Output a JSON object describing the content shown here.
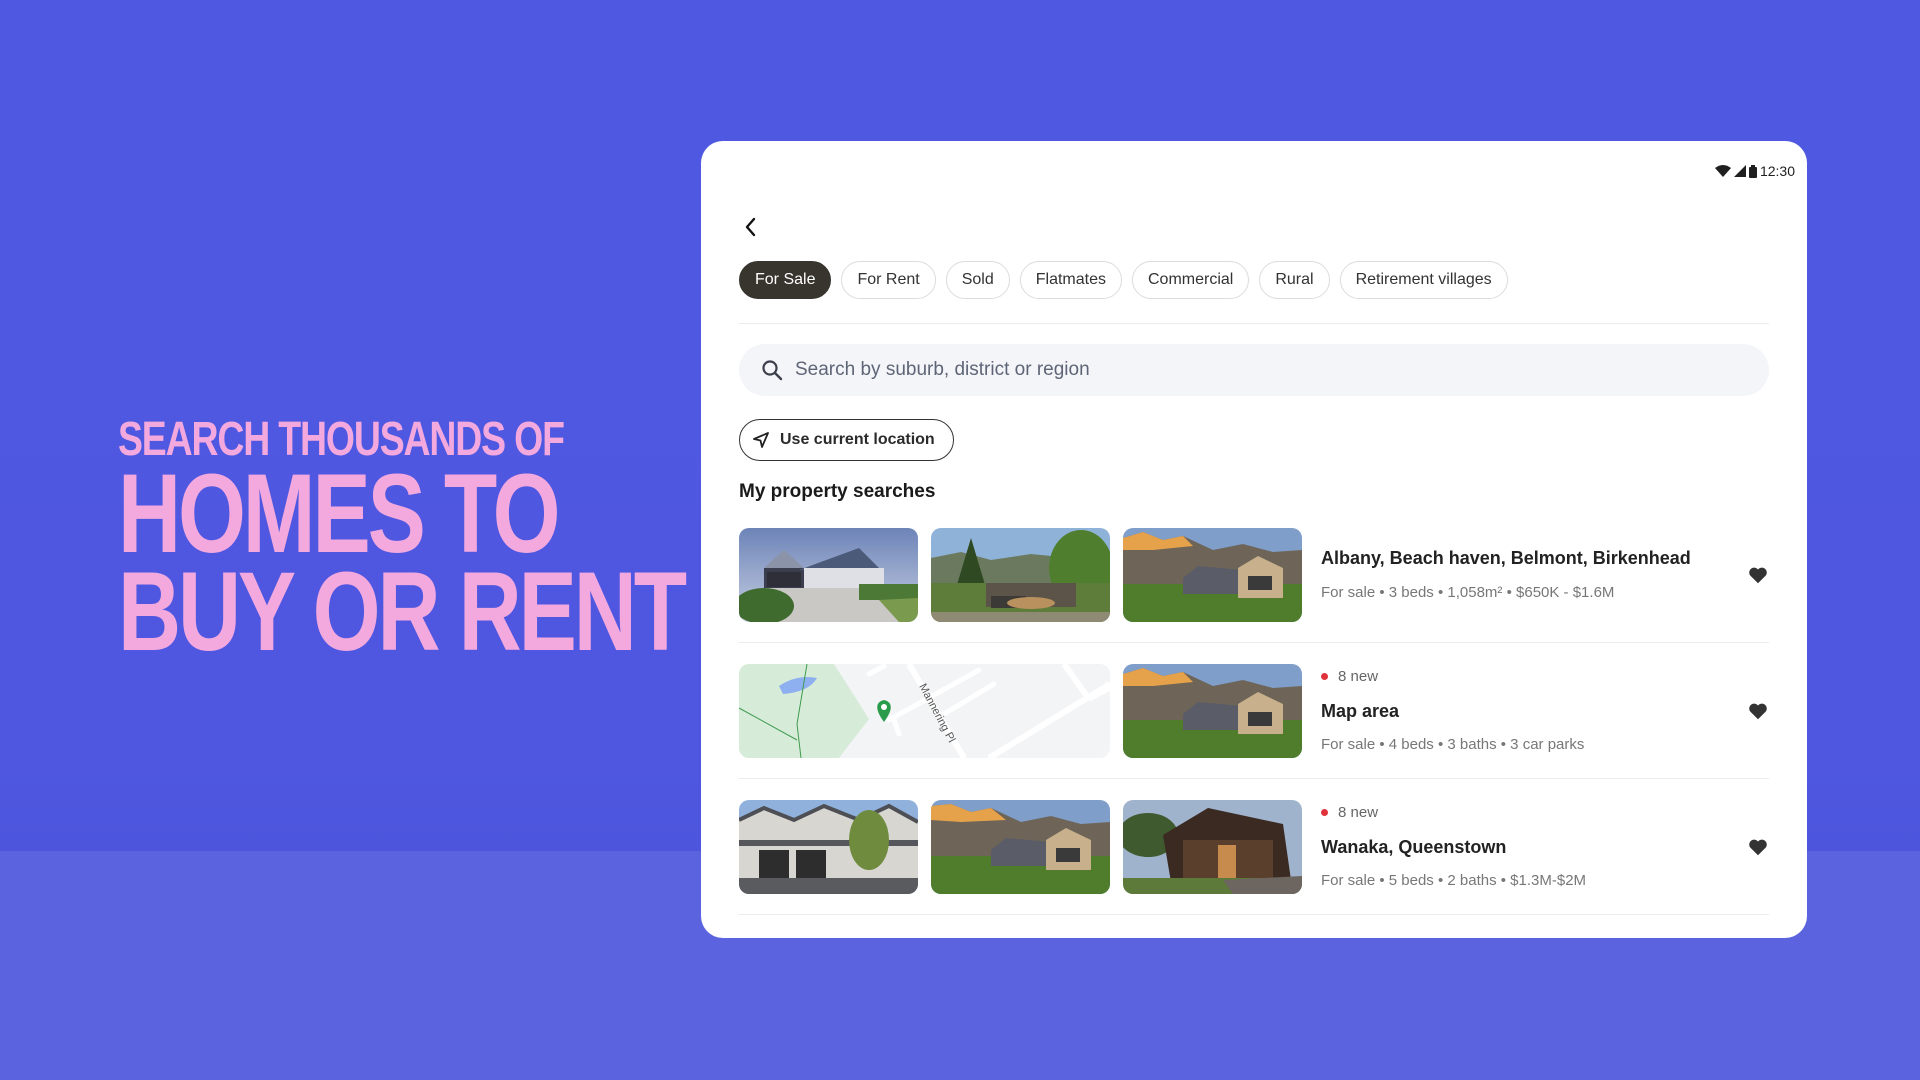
{
  "hero": {
    "line1": "Search thousands of",
    "line2": "Homes to",
    "line3": "Buy or rent"
  },
  "colors": {
    "background": "#4f58e0",
    "hero_text": "#f3a9de",
    "active_chip": "#38352f",
    "new_dot": "#e0323a"
  },
  "status_bar": {
    "icons": [
      "wifi-icon",
      "signal-icon",
      "battery-icon"
    ],
    "time": "12:30"
  },
  "nav": {
    "back_icon": "chevron-left-icon"
  },
  "chips": [
    {
      "label": "For Sale",
      "active": true
    },
    {
      "label": "For Rent",
      "active": false
    },
    {
      "label": "Sold",
      "active": false
    },
    {
      "label": "Flatmates",
      "active": false
    },
    {
      "label": "Commercial",
      "active": false
    },
    {
      "label": "Rural",
      "active": false
    },
    {
      "label": "Retirement villages",
      "active": false
    }
  ],
  "search": {
    "placeholder": "Search by suburb, district or region",
    "value": "",
    "icon": "search-icon"
  },
  "location_button": {
    "label": "Use current location",
    "icon": "navigation-arrow-icon"
  },
  "section_title": "My property searches",
  "searches": [
    {
      "badge": "",
      "title": "Albany, Beach haven, Belmont, Birkenhead",
      "subtitle": "For sale • 3 beds • 1,058m² • $650K - $1.6M",
      "thumbnails": [
        "house-photo-grey-garage",
        "house-photo-trees",
        "house-photo-mountain"
      ],
      "favorited": true
    },
    {
      "badge": "8 new",
      "title": "Map area",
      "subtitle": "For sale • 4 beds • 3 baths • 3 car parks",
      "thumbnails": [
        "map-thumbnail",
        "house-photo-mountain"
      ],
      "map_street_label": "Mannering Pl",
      "favorited": true
    },
    {
      "badge": "8 new",
      "title": "Wanaka, Queenstown",
      "subtitle": "For sale • 5 beds • 2 baths • $1.3M-$2M",
      "thumbnails": [
        "house-photo-townhouse",
        "house-photo-mountain",
        "house-photo-dark-timber"
      ],
      "favorited": true
    }
  ]
}
